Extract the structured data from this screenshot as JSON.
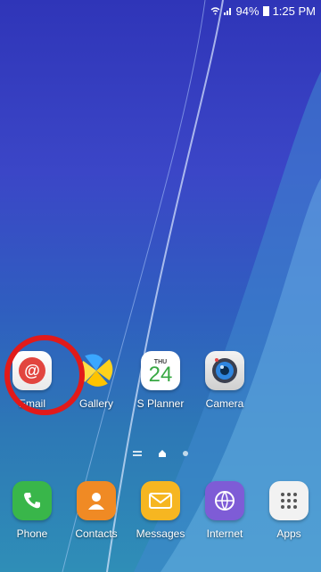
{
  "status_bar": {
    "battery_percent": "94%",
    "time": "1:25 PM"
  },
  "home_apps": [
    {
      "label": "Email"
    },
    {
      "label": "Gallery"
    },
    {
      "label": "S Planner",
      "day_of_week": "THU",
      "date": "24"
    },
    {
      "label": "Camera"
    }
  ],
  "dock_apps": [
    {
      "label": "Phone"
    },
    {
      "label": "Contacts"
    },
    {
      "label": "Messages"
    },
    {
      "label": "Internet"
    },
    {
      "label": "Apps"
    }
  ],
  "highlight": {
    "target": "Email",
    "color": "#e11a1a"
  }
}
